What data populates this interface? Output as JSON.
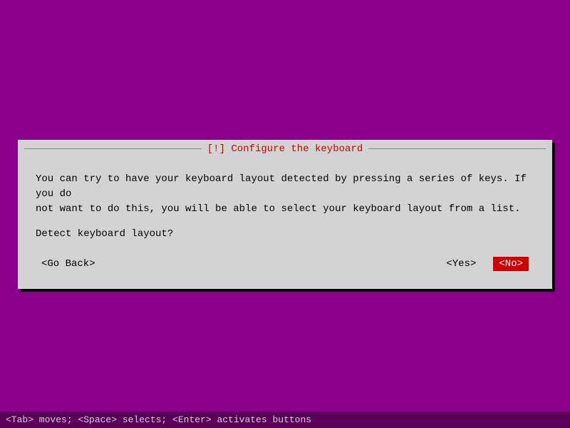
{
  "dialog": {
    "title": "[!] Configure the keyboard",
    "body_text": "You can try to have your keyboard layout detected by pressing a series of keys. If you do\nnot want to do this, you will be able to select your keyboard layout from a list.",
    "prompt": "Detect keyboard layout?",
    "btn_go_back": "<Go Back>",
    "btn_yes": "<Yes>",
    "btn_no": "<No>"
  },
  "status_bar": {
    "text": "<Tab> moves; <Space> selects; <Enter> activates buttons"
  }
}
